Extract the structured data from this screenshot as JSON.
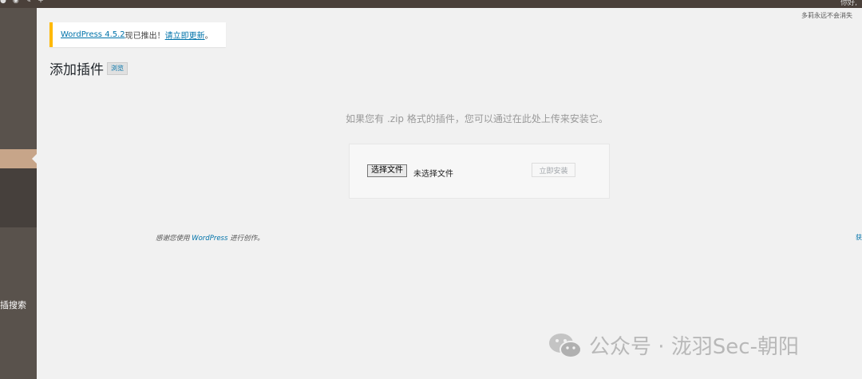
{
  "adminbar": {
    "right_text": "你好, "
  },
  "screen_note": "多莉永远不会消失",
  "notice": {
    "version_link": "WordPress 4.5.2",
    "text": " 现已推出！",
    "update_link": "请立即更新",
    "end": "。"
  },
  "page": {
    "title": "添加插件",
    "browse_label": "浏览"
  },
  "upload": {
    "help_text": "如果您有 .zip 格式的插件，您可以通过在此处上传来安装它。",
    "file_button": "选择文件",
    "file_status": "未选择文件",
    "install_button": "立即安装"
  },
  "sidebar": {
    "search_label": "插搜索"
  },
  "footer": {
    "prefix": "感谢您使用 ",
    "link": "WordPress",
    "suffix": " 进行创作。",
    "right": "获"
  },
  "watermark": {
    "text": "公众号 · 泷羽Sec-朝阳"
  },
  "colors": {
    "adminbar": "#4a403a",
    "sidebar": "#59524c",
    "sidebar_current": "#c7a589",
    "notice_border": "#ffb900",
    "link": "#0073aa"
  }
}
